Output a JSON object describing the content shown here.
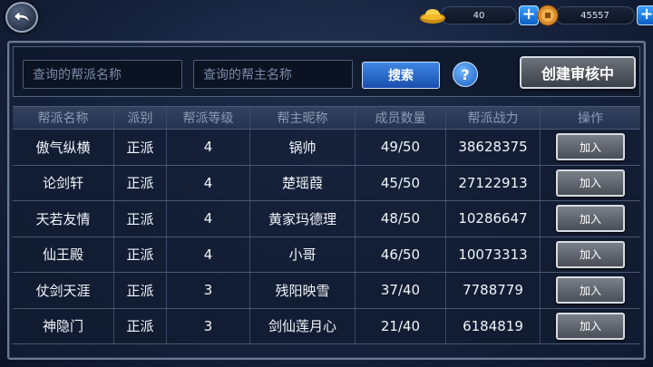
{
  "topbar": {
    "back_icon": "back-arrow-icon",
    "gold": {
      "icon": "gold-ingot-icon",
      "value": "40"
    },
    "coins": {
      "icon": "copper-coin-icon",
      "value": "45557"
    },
    "plus_label": "+"
  },
  "search": {
    "guild_name_placeholder": "查询的帮派名称",
    "leader_name_placeholder": "查询的帮主名称",
    "search_label": "搜索",
    "help_label": "?",
    "review_label": "创建审核中"
  },
  "table": {
    "headers": [
      "帮派名称",
      "派别",
      "帮派等级",
      "帮主昵称",
      "成员数量",
      "帮派战力",
      "操作"
    ],
    "rows": [
      {
        "name": "傲气纵横",
        "faction": "正派",
        "level": "4",
        "leader": "锅帅",
        "members": "49/50",
        "power": "38628375",
        "action": "加入"
      },
      {
        "name": "论剑轩",
        "faction": "正派",
        "level": "4",
        "leader": "楚瑶葭",
        "members": "45/50",
        "power": "27122913",
        "action": "加入"
      },
      {
        "name": "天若友情",
        "faction": "正派",
        "level": "4",
        "leader": "黄家玛德理",
        "members": "48/50",
        "power": "10286647",
        "action": "加入"
      },
      {
        "name": "仙王殿",
        "faction": "正派",
        "level": "4",
        "leader": "小哥",
        "members": "46/50",
        "power": "10073313",
        "action": "加入"
      },
      {
        "name": "仗剑天涯",
        "faction": "正派",
        "level": "3",
        "leader": "残阳映雪",
        "members": "37/40",
        "power": "7788779",
        "action": "加入"
      },
      {
        "name": "神隐门",
        "faction": "正派",
        "level": "3",
        "leader": "剑仙莲月心",
        "members": "21/40",
        "power": "6184819",
        "action": "加入"
      }
    ]
  }
}
